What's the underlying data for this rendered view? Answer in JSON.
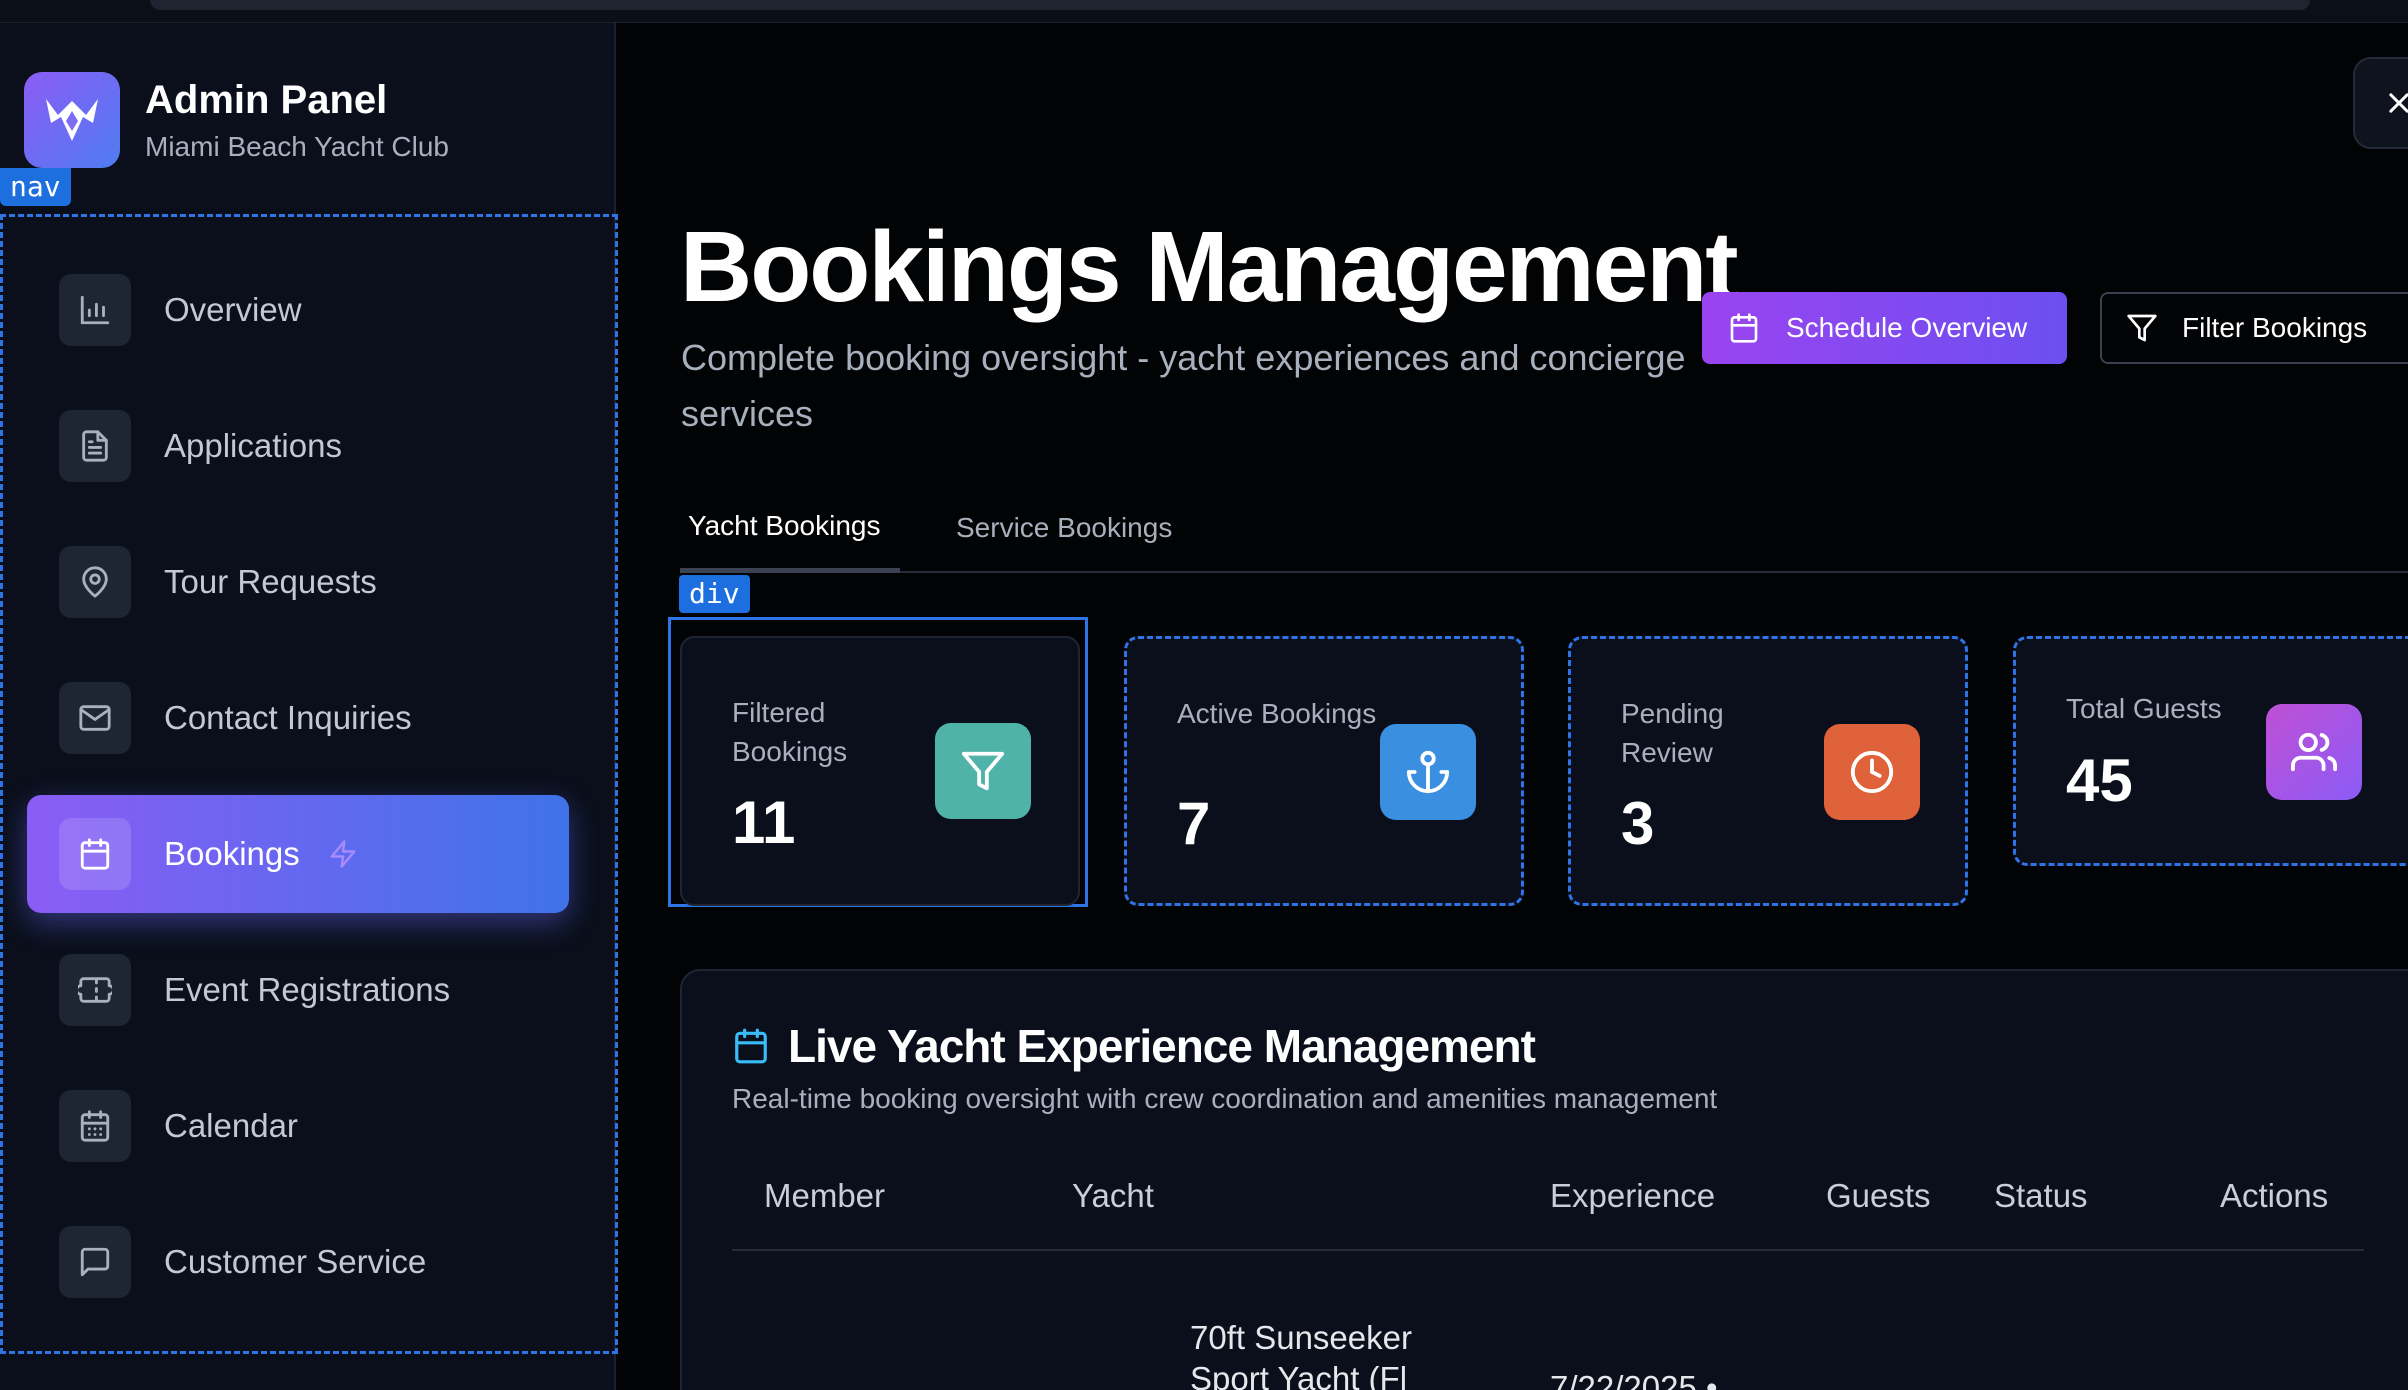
{
  "sidebar": {
    "brand": {
      "title": "Admin Panel",
      "subtitle": "Miami Beach Yacht Club"
    },
    "nav_tag": "nav",
    "items": [
      {
        "label": "Overview",
        "icon": "bar-chart-icon"
      },
      {
        "label": "Applications",
        "icon": "document-icon"
      },
      {
        "label": "Tour Requests",
        "icon": "map-pin-icon"
      },
      {
        "label": "Contact Inquiries",
        "icon": "mail-icon"
      },
      {
        "label": "Bookings",
        "icon": "calendar-icon",
        "active": true,
        "badge_icon": "lightning-icon"
      },
      {
        "label": "Event Registrations",
        "icon": "ticket-icon"
      },
      {
        "label": "Calendar",
        "icon": "calendar-grid-icon"
      },
      {
        "label": "Customer Service",
        "icon": "message-square-icon"
      }
    ]
  },
  "header": {
    "title": "Bookings Management",
    "subtitle": "Complete booking oversight - yacht experiences and concierge services",
    "schedule_button": "Schedule Overview",
    "filter_button": "Filter Bookings"
  },
  "tabs": [
    {
      "label": "Yacht Bookings",
      "active": true
    },
    {
      "label": "Service Bookings",
      "active": false
    }
  ],
  "debug": {
    "div_tag": "div"
  },
  "stats": [
    {
      "label": "Filtered Bookings",
      "value": "11",
      "icon": "filter-icon",
      "color": "#4fb3a9"
    },
    {
      "label": "Active Bookings",
      "value": "7",
      "icon": "anchor-icon",
      "color": "#3b8fe0"
    },
    {
      "label": "Pending Review",
      "value": "3",
      "icon": "clock-icon",
      "color": "#e0623a"
    },
    {
      "label": "Total Guests",
      "value": "45",
      "icon": "users-icon",
      "color": "#b150d8"
    }
  ],
  "panel": {
    "title": "Live Yacht Experience Management",
    "subtitle": "Real-time booking oversight with crew coordination and amenities management",
    "columns": [
      "Member",
      "Yacht",
      "Experience",
      "Guests",
      "Status",
      "Actions"
    ],
    "rows": [
      {
        "yacht": "70ft Sunseeker Sport Yacht (Fl",
        "experience": "7/22/2025 •"
      }
    ]
  },
  "colors": {
    "accent_gradient_start": "#8b5cf6",
    "accent_gradient_end": "#3f73ea",
    "debug_outline": "#2f74e6"
  }
}
